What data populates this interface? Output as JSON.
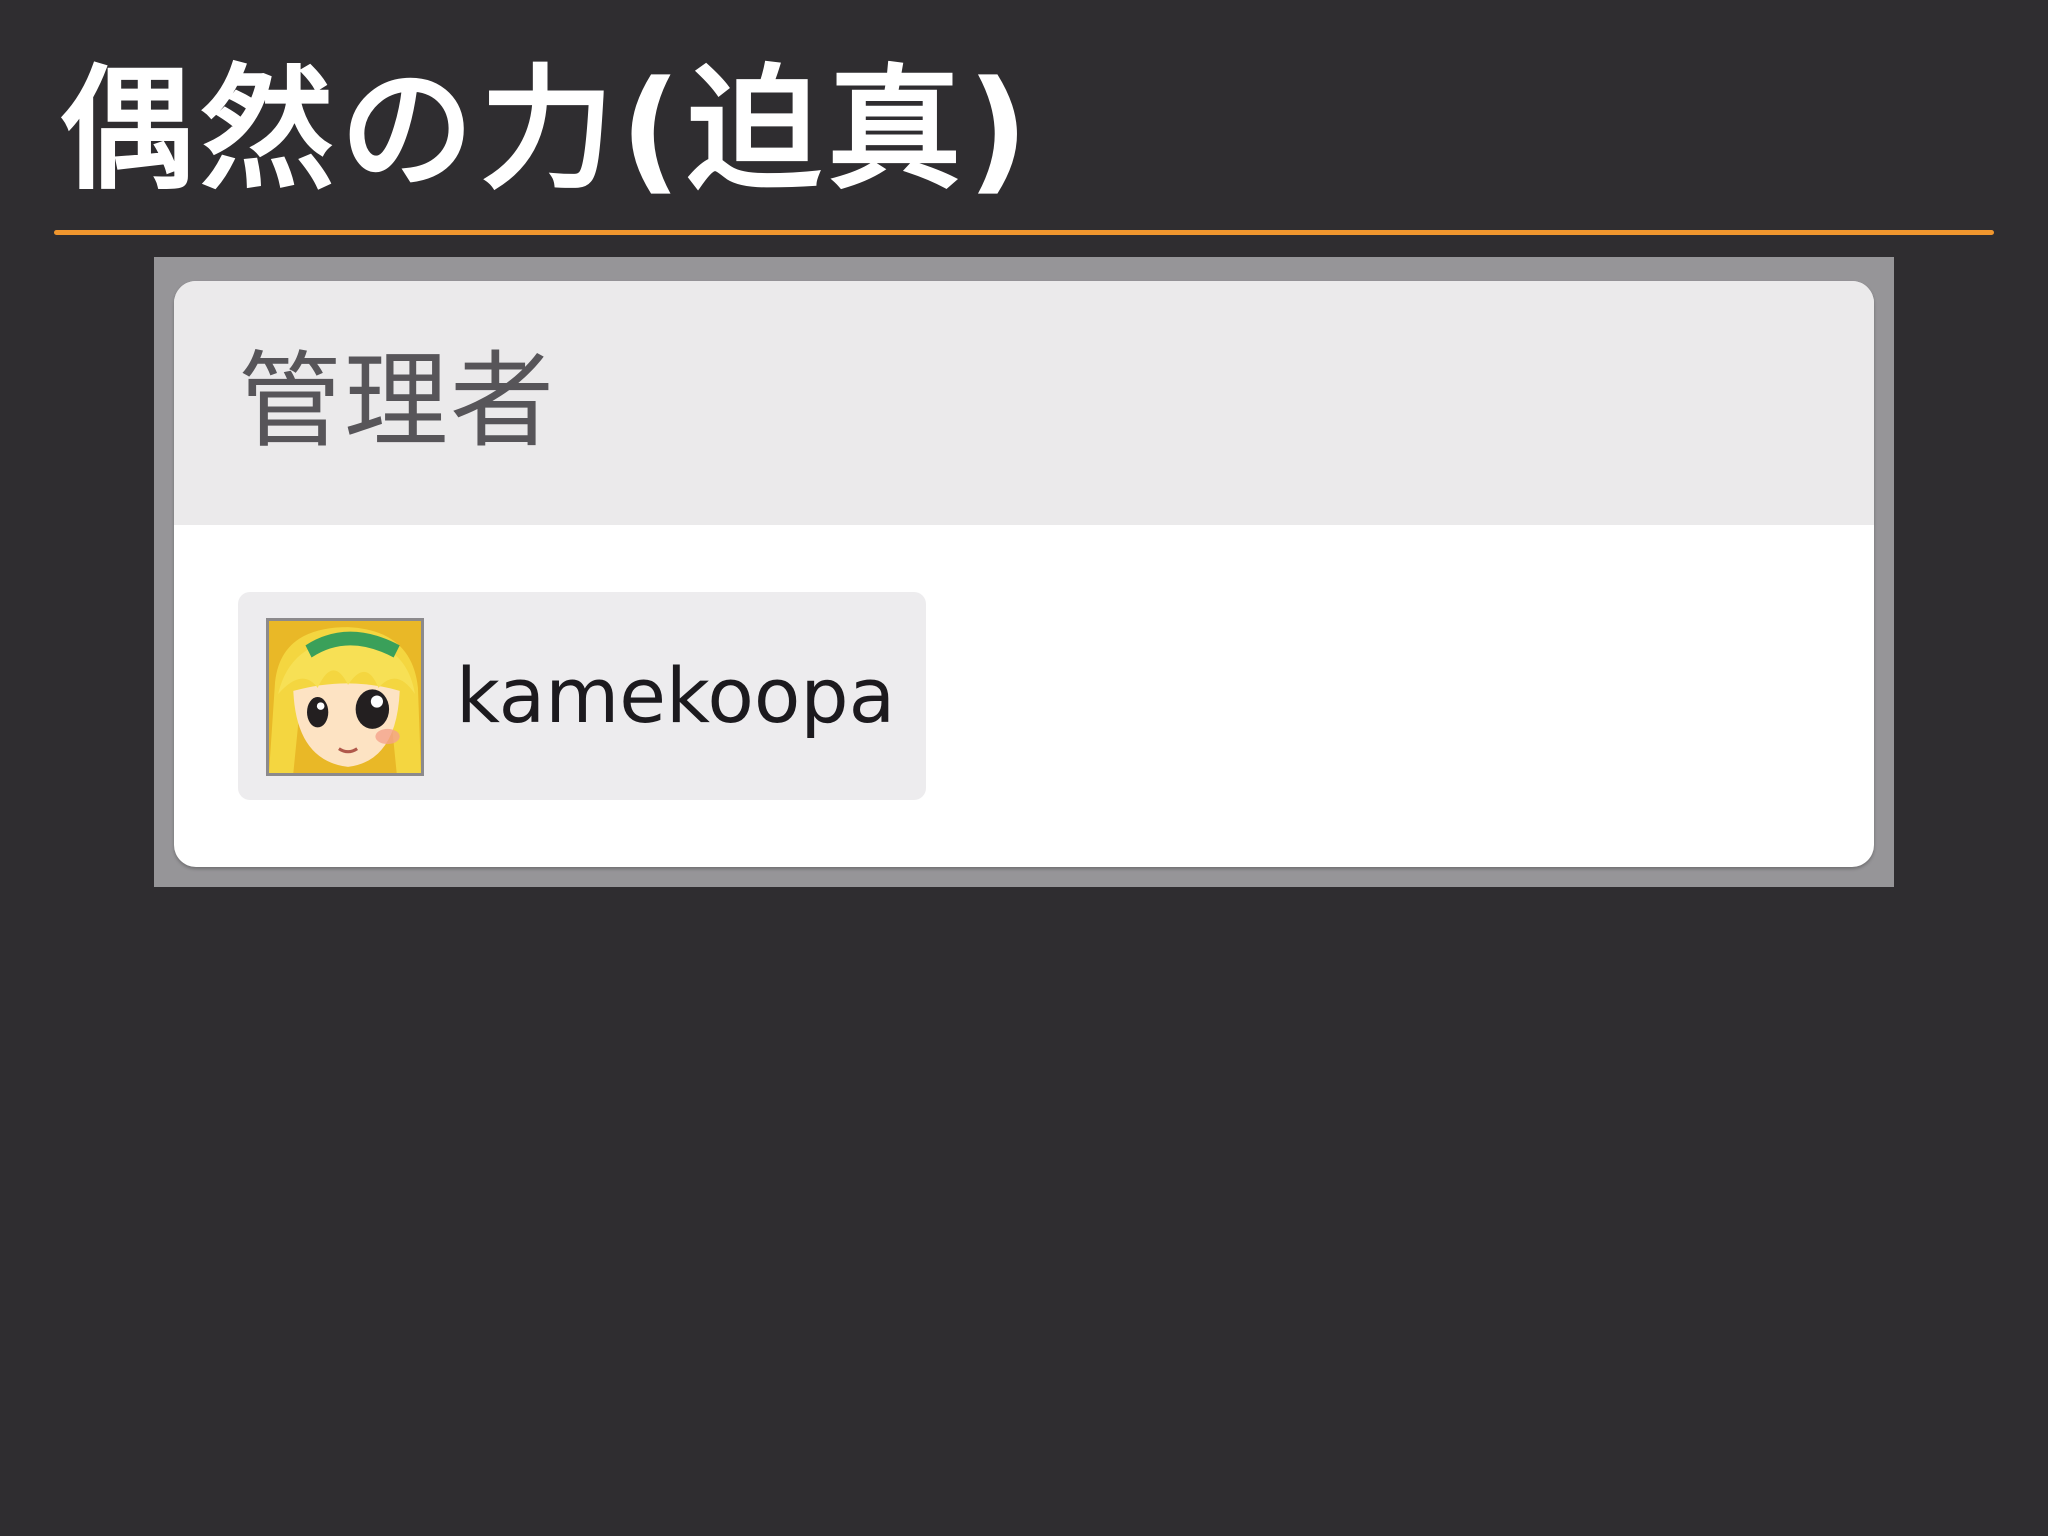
{
  "slide": {
    "title": "偶然の力(迫真)",
    "accent_color": "#f0962e",
    "background_color": "#2f2d30"
  },
  "admin_panel": {
    "heading": "管理者",
    "members": [
      {
        "name": "kamekoopa",
        "avatar_icon": "anime-girl-avatar-icon"
      }
    ]
  }
}
